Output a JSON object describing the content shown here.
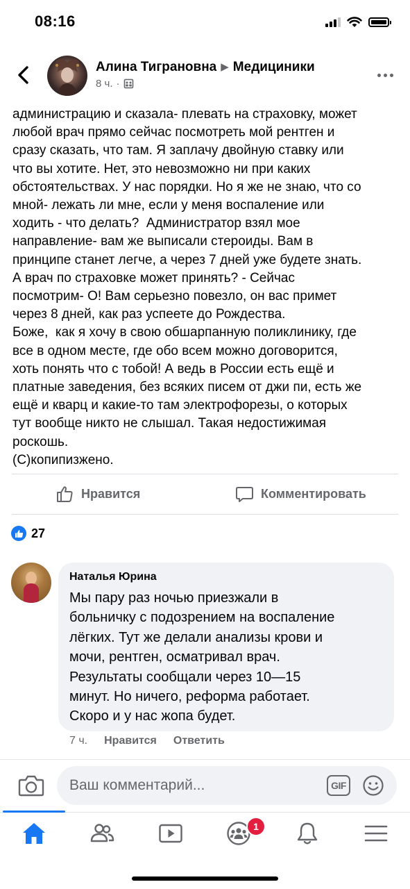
{
  "status_bar": {
    "time": "08:16"
  },
  "post": {
    "author": "Алина Тиграновна",
    "group": "Медициники",
    "time": "8 ч.",
    "separator": "·",
    "text": "администрацию и сказала- плевать на страховку, может\nлюбой врач прямо сейчас посмотреть мой рентген и\nсразу сказать, что там. Я заплачу двойную ставку или\nчто вы хотите. Нет, это невозможно ни при каких\nобстоятельствах. У нас порядки. Но я же не знаю, что со\nмной- лежать ли мне, если у меня воспаление или\nходить - что делать?  Администратор взял мое\nнаправление- вам же выписали стероиды. Вам в\nпринципе станет легче, а через 7 дней уже будете знать.\nА врач по страховке может принять? - Сейчас\nпосмотрим- О! Вам серьезно повезло, он вас примет\nчерез 8 дней, как раз успеете до Рождества.\nБоже,  как я хочу в свою обшарпанную поликлинику, где\nвсе в одном месте, где обо всем можно договорится,\nхоть понять что с тобой! А ведь в России есть ещё и\nплатные заведения, без всяких писем от джи пи, есть же\nещё и кварц и какие-то там электрофорезы, о которых\nтут вообще никто не слышал. Такая недостижимая\nроскошь.\n(С)копипизжено."
  },
  "actions": {
    "like": "Нравится",
    "comment": "Комментировать"
  },
  "reactions": {
    "count": "27"
  },
  "comment": {
    "author": "Наталья Юрина",
    "text": "Мы пару раз ночью приезжали в\nбольничку с подозрением на воспаление\nлёгких. Тут же делали анализы крови и\nмочи, рентген, осматривал врач.\nРезультаты сообщали через 10—15\nминут. Но ничего, реформа работает.\nСкоро и у нас жопа будет.",
    "time": "7 ч.",
    "like": "Нравится",
    "reply": "Ответить"
  },
  "composer": {
    "placeholder": "Ваш комментарий...",
    "gif": "GIF"
  },
  "nav": {
    "groups_badge": "1"
  },
  "colors": {
    "accent": "#1877f2",
    "badge": "#e41e3f",
    "bubble": "#f0f2f5",
    "secondary_text": "#65676b"
  },
  "icons": [
    "back-icon",
    "more-icon",
    "audience-icon",
    "like-icon",
    "comment-icon",
    "like-reaction-icon",
    "camera-icon",
    "gif-icon",
    "emoji-icon",
    "home-icon",
    "friends-icon",
    "watch-icon",
    "groups-icon",
    "notifications-icon",
    "menu-icon"
  ]
}
